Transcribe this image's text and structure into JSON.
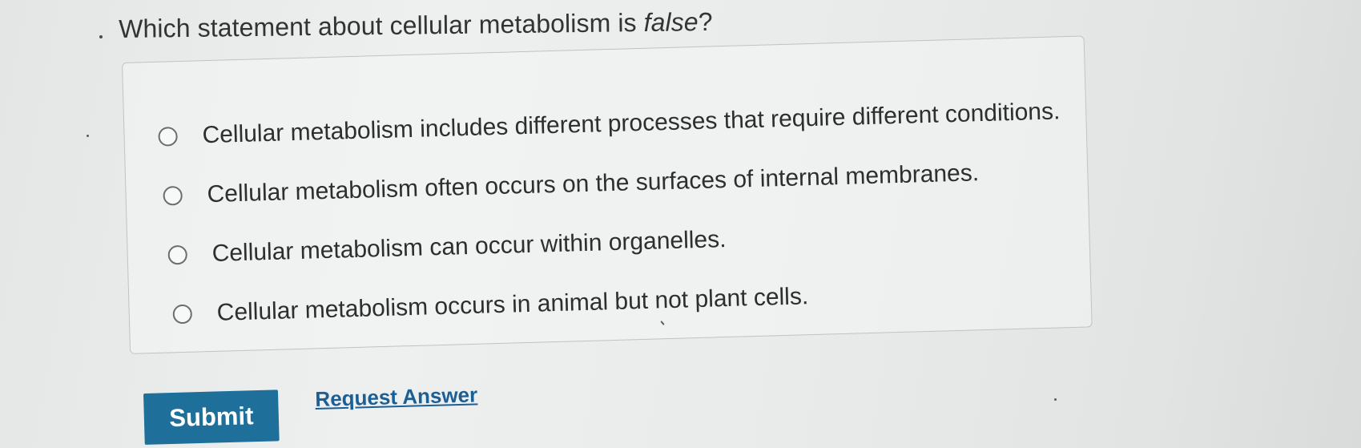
{
  "question": {
    "prefix": "Which statement about cellular metabolism is ",
    "emphasis": "false",
    "suffix": "?"
  },
  "options": [
    {
      "label": "Cellular metabolism includes different processes that require different conditions."
    },
    {
      "label": "Cellular metabolism often occurs on the surfaces of internal membranes."
    },
    {
      "label": "Cellular metabolism can occur within organelles."
    },
    {
      "label": "Cellular metabolism occurs in animal but not plant cells."
    }
  ],
  "actions": {
    "submit_label": "Submit",
    "request_answer_label": "Request Answer"
  },
  "colors": {
    "submit_bg": "#1f6f9b",
    "link": "#1c5f94"
  }
}
